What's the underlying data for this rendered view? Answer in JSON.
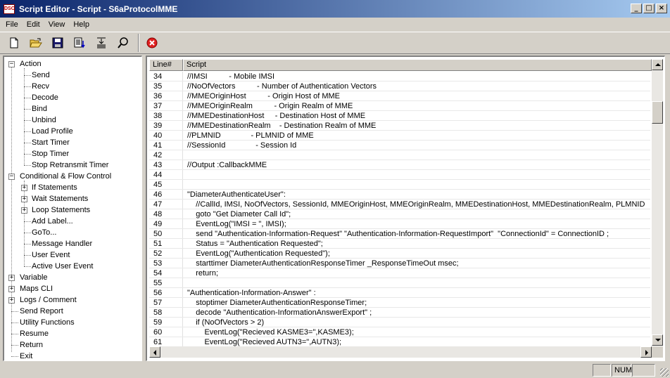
{
  "window": {
    "title": "Script Editor - Script - S6aProtocolMME",
    "icon_label": "DSC",
    "controls": {
      "minimize": "_",
      "maximize": "□",
      "close": "×"
    }
  },
  "menu": [
    "File",
    "Edit",
    "View",
    "Help"
  ],
  "toolbar": {
    "tools": [
      "new-file-icon",
      "open-folder-icon",
      "save-disk-icon",
      "import-icon",
      "export-icon",
      "find-icon",
      "stop-icon"
    ]
  },
  "tree": {
    "nodes": [
      {
        "label": "Action",
        "expander": "−"
      },
      {
        "label": "Send"
      },
      {
        "label": "Recv"
      },
      {
        "label": "Decode"
      },
      {
        "label": "Bind"
      },
      {
        "label": "Unbind"
      },
      {
        "label": "Load Profile"
      },
      {
        "label": "Start Timer"
      },
      {
        "label": "Stop Timer"
      },
      {
        "label": "Stop Retransmit Timer"
      },
      {
        "label": "Conditional & Flow Control",
        "expander": "−"
      },
      {
        "label": "If Statements",
        "expander": "+"
      },
      {
        "label": "Wait Statements",
        "expander": "+"
      },
      {
        "label": "Loop Statements",
        "expander": "+"
      },
      {
        "label": "Add Label..."
      },
      {
        "label": "GoTo..."
      },
      {
        "label": "Message Handler"
      },
      {
        "label": "User Event"
      },
      {
        "label": "Active User Event"
      },
      {
        "label": "Variable",
        "expander": "+"
      },
      {
        "label": "Maps CLI",
        "expander": "+"
      },
      {
        "label": "Logs / Comment",
        "expander": "+"
      },
      {
        "label": "Send Report"
      },
      {
        "label": "Utility Functions"
      },
      {
        "label": "Resume"
      },
      {
        "label": "Return"
      },
      {
        "label": "Exit"
      }
    ]
  },
  "script": {
    "columns": [
      "Line#",
      "Script"
    ],
    "rows": [
      {
        "n": "34",
        "code": "//IMSI          - Mobile IMSI"
      },
      {
        "n": "35",
        "code": "//NoOfVectors          - Number of Authentication Vectors"
      },
      {
        "n": "36",
        "code": "//MMEOriginHost          - Origin Host of MME"
      },
      {
        "n": "37",
        "code": "//MMEOriginRealm          - Origin Realm of MME"
      },
      {
        "n": "38",
        "code": "//MMEDestinationHost     - Destination Host of MME"
      },
      {
        "n": "39",
        "code": "//MMEDestinationRealm    - Destination Realm of MME"
      },
      {
        "n": "40",
        "code": "//PLMNID              - PLMNID of MME"
      },
      {
        "n": "41",
        "code": "//SessionId              - Session Id"
      },
      {
        "n": "42",
        "code": ""
      },
      {
        "n": "43",
        "code": "//Output :CallbackMME"
      },
      {
        "n": "44",
        "code": ""
      },
      {
        "n": "45",
        "code": ""
      },
      {
        "n": "46",
        "code": "\"DiameterAuthenticateUser\":"
      },
      {
        "n": "47",
        "code": "    //CallId, IMSI, NoOfVectors, SessionId, MMEOriginHost, MMEOriginRealm, MMEDestinationHost, MMEDestinationRealm, PLMNID"
      },
      {
        "n": "48",
        "code": "    goto \"Get Diameter Call Id\";"
      },
      {
        "n": "49",
        "code": "    EventLog(\"IMSI = \", IMSI);"
      },
      {
        "n": "50",
        "code": "    send \"Authentication-Information-Request\" \"Authentication-Information-RequestImport\"  \"ConnectionId\" = ConnectionID ;"
      },
      {
        "n": "51",
        "code": "    Status = \"Authentication Requested\";"
      },
      {
        "n": "52",
        "code": "    EventLog(\"Authentication Requested\");"
      },
      {
        "n": "53",
        "code": "    starttimer DiameterAuthenticationResponseTimer _ResponseTimeOut msec;"
      },
      {
        "n": "54",
        "code": "    return;"
      },
      {
        "n": "55",
        "code": ""
      },
      {
        "n": "56",
        "code": "\"Authentication-Information-Answer\" :"
      },
      {
        "n": "57",
        "code": "    stoptimer DiameterAuthenticationResponseTimer;"
      },
      {
        "n": "58",
        "code": "    decode \"Authentication-InformationAnswerExport\" ;"
      },
      {
        "n": "59",
        "code": "    if (NoOfVectors > 2)"
      },
      {
        "n": "60",
        "code": "        EventLog(\"Recieved KASME3=\",KASME3);"
      },
      {
        "n": "61",
        "code": "        EventLog(\"Recieved AUTN3=\",AUTN3);"
      }
    ]
  },
  "status": {
    "panes": [
      "",
      "NUM",
      ""
    ]
  }
}
